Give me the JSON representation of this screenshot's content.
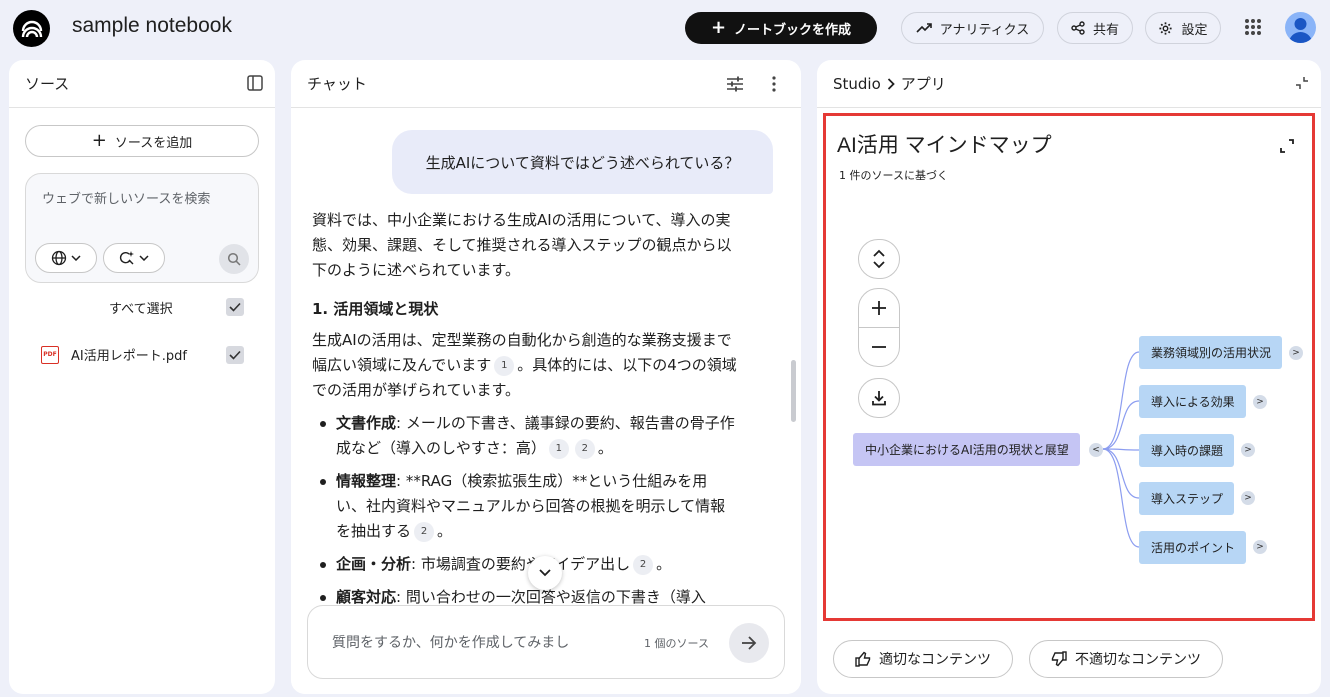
{
  "header": {
    "app_title": "sample notebook",
    "create_label": "ノートブックを作成",
    "analytics_label": "アナリティクス",
    "share_label": "共有",
    "settings_label": "設定"
  },
  "sources": {
    "title": "ソース",
    "add_label": "ソースを追加",
    "search_placeholder": "ウェブで新しいソースを検索",
    "select_all_label": "すべて選択",
    "items": [
      {
        "name": "AI活用レポート.pdf",
        "checked": true
      }
    ]
  },
  "chat": {
    "title": "チャット",
    "user_message": "生成AIについて資料ではどう述べられている？",
    "intro": "資料では、中小企業における生成AIの活用について、導入の実態、効果、課題、そして推奨される導入ステップの観点から以下のように述べられています。",
    "section1_heading": "1. 活用領域と現状",
    "section1_text_a": "生成AIの活用は、定型業務の自動化から創造的な業務支援まで幅広い領域に及んでいます",
    "section1_text_b": "。具体的には、以下の4つの領域での活用が挙げられています。",
    "bullets": [
      {
        "term": "文書作成",
        "text": ": メールの下書き、議事録の要約、報告書の骨子作成など（導入のしやすさ：高）",
        "cites": [
          "1",
          "2"
        ],
        "tail": "。"
      },
      {
        "term": "情報整理",
        "text": ": **RAG（検索拡張生成）**という仕組みを用い、社内資料やマニュアルから回答の根拠を明示して情報を抽出する",
        "cites": [
          "2"
        ],
        "tail": "。"
      },
      {
        "term": "企画・分析",
        "text": ": 市場調査の要約やアイデア出し",
        "cites": [
          "2"
        ],
        "tail": "。"
      },
      {
        "term": "顧客対応",
        "text": ": 問い合わせの一次回答や返信の下書き（導入",
        "cites": [],
        "tail": ""
      }
    ],
    "cite_1": "1",
    "input_placeholder": "質問をするか、何かを作成してみまし",
    "source_count": "1 個のソース"
  },
  "studio": {
    "breadcrumb_root": "Studio",
    "breadcrumb_current": "アプリ",
    "mindmap_title": "AI活用 マインドマップ",
    "mindmap_subtitle": "1 件のソースに基づく",
    "root_node": "中小企業におけるAI活用の現状と展望",
    "child_nodes": [
      "業務領域別の活用状況",
      "導入による効果",
      "導入時の課題",
      "導入ステップ",
      "活用のポイント"
    ],
    "good_label": "適切なコンテンツ",
    "bad_label": "不適切なコンテンツ"
  },
  "colors": {
    "accent_red": "#e53935",
    "root_node": "#c5c5f4",
    "child_node": "#b7d6f5",
    "connector": "#8c9df0"
  }
}
